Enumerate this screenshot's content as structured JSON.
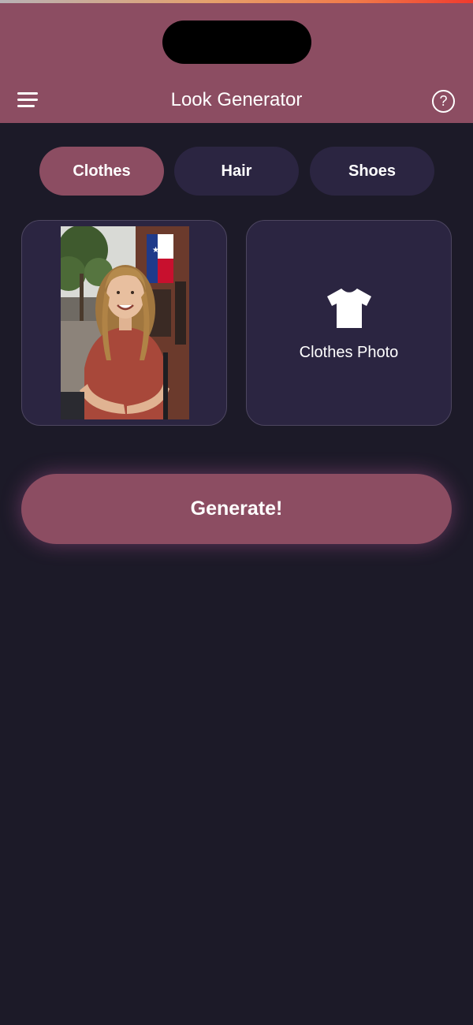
{
  "app": {
    "title": "Look Generator"
  },
  "header": {
    "menu_icon": "hamburger-menu-icon",
    "help_icon": "question-circle-icon",
    "help_glyph": "?"
  },
  "tabs": [
    {
      "label": "Clothes",
      "active": true
    },
    {
      "label": "Hair",
      "active": false
    },
    {
      "label": "Shoes",
      "active": false
    }
  ],
  "upload": {
    "person_photo": {
      "icon": "person-photo"
    },
    "clothes_photo": {
      "label": "Clothes Photo",
      "icon": "tshirt-icon"
    }
  },
  "actions": {
    "generate_label": "Generate!"
  },
  "colors": {
    "header": "#8c4d62",
    "background": "#1c1a28",
    "card": "#2b2541",
    "accent": "#8c4d62"
  }
}
